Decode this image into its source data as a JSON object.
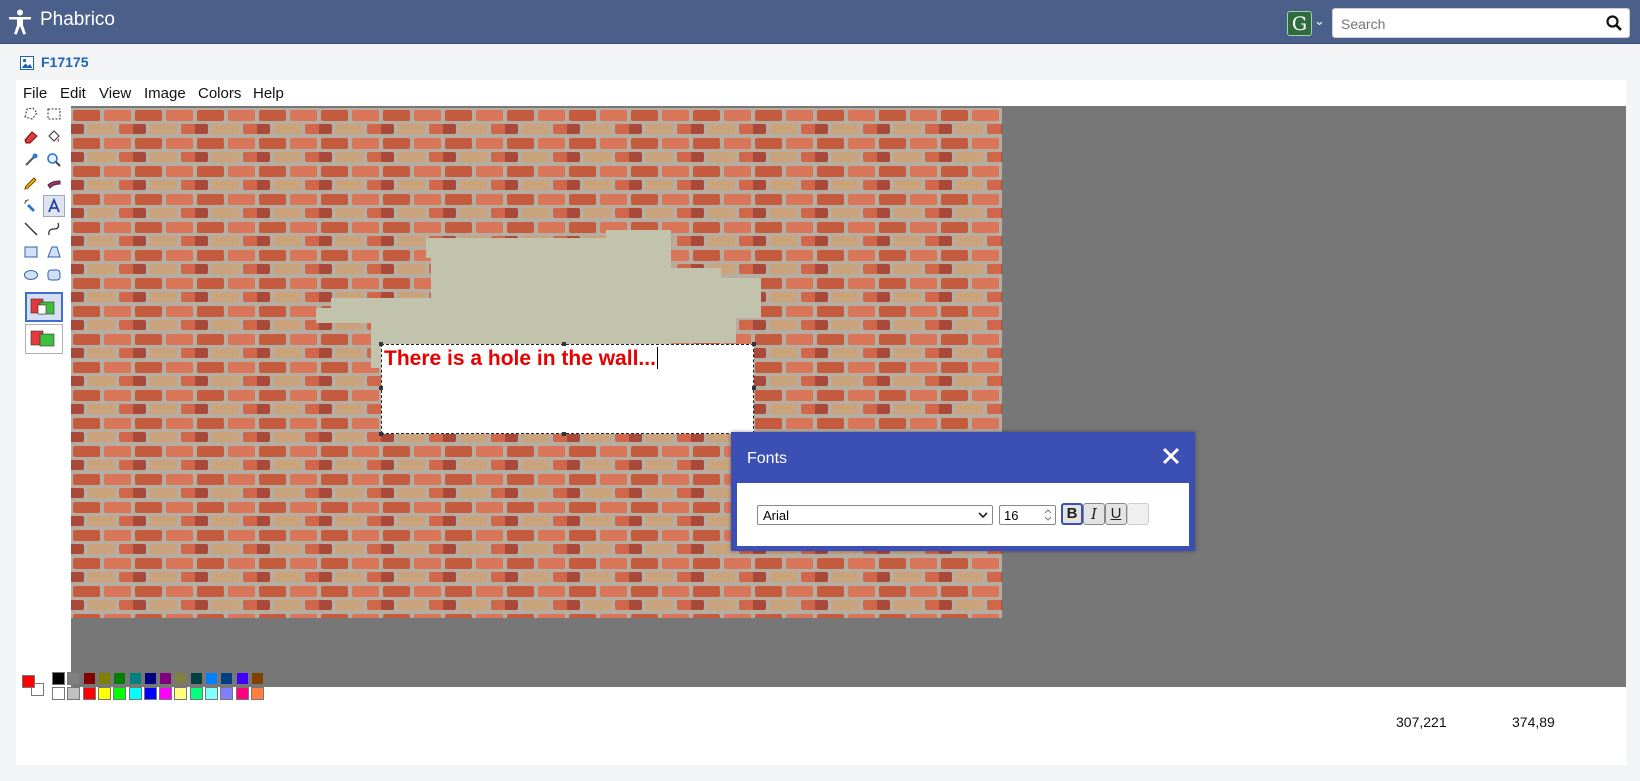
{
  "app": {
    "title": "Phabrico",
    "user_badge": "G"
  },
  "search": {
    "placeholder": "Search"
  },
  "file": {
    "id": "F17175"
  },
  "menu": [
    "File",
    "Edit",
    "View",
    "Image",
    "Colors",
    "Help"
  ],
  "tools": [
    {
      "name": "free-select-icon"
    },
    {
      "name": "rect-select-icon"
    },
    {
      "name": "eraser-icon"
    },
    {
      "name": "fill-bucket-icon"
    },
    {
      "name": "color-picker-icon"
    },
    {
      "name": "magnifier-icon"
    },
    {
      "name": "pencil-icon"
    },
    {
      "name": "brush-icon"
    },
    {
      "name": "airbrush-icon"
    },
    {
      "name": "text-icon",
      "selected": true
    },
    {
      "name": "line-icon"
    },
    {
      "name": "curve-icon"
    },
    {
      "name": "rectangle-icon"
    },
    {
      "name": "polygon-icon"
    },
    {
      "name": "ellipse-icon"
    },
    {
      "name": "rounded-rect-icon"
    }
  ],
  "canvas_text": "There is a hole in the wall...",
  "fonts_dialog": {
    "title": "Fonts",
    "font_family": "Arial",
    "font_size": "16",
    "bold_label": "B",
    "italic_label": "I",
    "underline_label": "U",
    "bold_active": true
  },
  "palette": {
    "primary": "#ff0000",
    "secondary": "#ffffff",
    "row1": [
      "#000000",
      "#808080",
      "#800000",
      "#808000",
      "#008000",
      "#008080",
      "#000080",
      "#800080",
      "#808040",
      "#004040",
      "#0080ff",
      "#004080",
      "#4000ff",
      "#804000"
    ],
    "row2": [
      "#ffffff",
      "#c0c0c0",
      "#ff0000",
      "#ffff00",
      "#00ff00",
      "#00ffff",
      "#0000ff",
      "#ff00ff",
      "#ffff80",
      "#00ff80",
      "#80ffff",
      "#8080ff",
      "#ff0080",
      "#ff8040"
    ]
  },
  "status": {
    "cursor_pos": "307,221",
    "selection_size": "374,89"
  },
  "colors": {
    "topbar": "#4a5f8a",
    "dialog": "#3b4fb5",
    "link": "#1f63b3"
  }
}
